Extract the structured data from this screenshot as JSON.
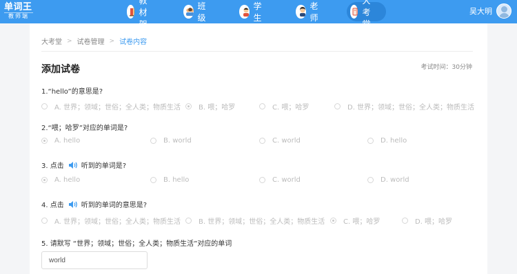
{
  "app": {
    "logo_line1": "单词王",
    "logo_line2": "教师端"
  },
  "nav": {
    "items": [
      {
        "label": "教材架",
        "icon": "bookshelf-icon"
      },
      {
        "label": "班级",
        "icon": "class-icon"
      },
      {
        "label": "学生",
        "icon": "student-icon"
      },
      {
        "label": "老师",
        "icon": "teacher-icon"
      },
      {
        "label": "大考堂",
        "icon": "exam-hall-icon",
        "active": true
      }
    ]
  },
  "user": {
    "name": "吴大明"
  },
  "breadcrumb": {
    "items": [
      "大考堂",
      "试卷管理",
      "试卷内容"
    ]
  },
  "page": {
    "title": "添加试卷",
    "exam_time": "考试时间：30分钟"
  },
  "questions": [
    {
      "prompt": "1.“hello”的意思是?",
      "options": [
        "A. 世界；领域；世俗；全人类；物质生活",
        "B. 喂；哈罗",
        "C. 喂；哈罗",
        "D. 世界；领域；世俗；全人类；物质生活"
      ],
      "selected": 1
    },
    {
      "prompt": "2.“喂；哈罗”对应的单词是?",
      "options": [
        "A. hello",
        "B. world",
        "C. world",
        "D. hello"
      ],
      "selected": 0
    },
    {
      "prompt_prefix": "3.  点击",
      "prompt_suffix": "听到的单词是?",
      "options": [
        "A. hello",
        "B. hello",
        "C. world",
        "D. world"
      ],
      "selected": 0
    },
    {
      "prompt_prefix": "4.  点击",
      "prompt_suffix": "听到的单词的意思是?",
      "options": [
        "A. 世界；领域；世俗；全人类；物质生活",
        "B. 世界；领域；世俗；全人类；物质生活",
        "C. 喂；哈罗",
        "D. 喂；哈罗"
      ],
      "selected": 2
    },
    {
      "prompt": "5.  请默写 “世界；领域；世俗；全人类；物质生活”对应的单词",
      "answer": "world"
    }
  ],
  "colors": {
    "topbar": "#3d9bf0",
    "accent": "#3d9bf0",
    "option_text": "#bbbbbb"
  }
}
